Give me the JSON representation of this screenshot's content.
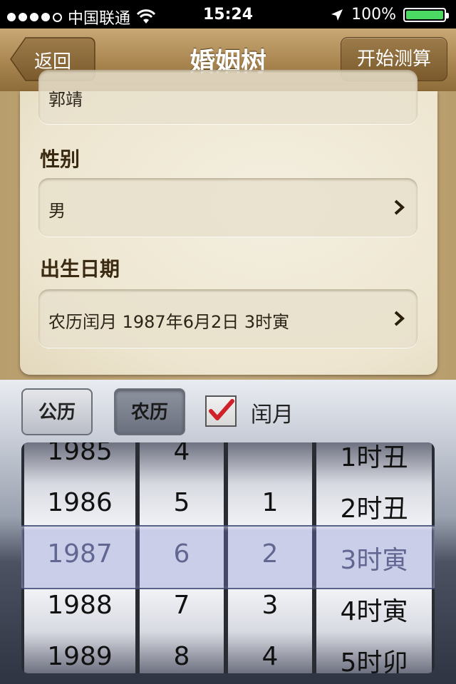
{
  "statusbar": {
    "carrier": "中国联通",
    "time": "15:24",
    "battery": "100%"
  },
  "navbar": {
    "back_label": "返回",
    "title": "婚姻树",
    "start_label": "开始测算"
  },
  "form": {
    "name_value": "郭靖",
    "gender_label": "性别",
    "gender_value": "男",
    "birth_label": "出生日期",
    "birth_value": "农历闰月 1987年6月2日 3时寅"
  },
  "picker": {
    "solar_label": "公历",
    "lunar_label": "农历",
    "leap_label": "闰月",
    "leap_checked": true,
    "columns": [
      {
        "name": "year",
        "rows": [
          "1985",
          "1986",
          "1987",
          "1988",
          "1989"
        ]
      },
      {
        "name": "month",
        "rows": [
          "4",
          "5",
          "6",
          "7",
          "8"
        ]
      },
      {
        "name": "day",
        "rows": [
          "",
          "1",
          "2",
          "3",
          "4"
        ]
      },
      {
        "name": "hour",
        "rows": [
          "1时丑",
          "2时丑",
          "3时寅",
          "4时寅",
          "5时卯"
        ]
      }
    ]
  },
  "colors": {
    "nav_brown": "#a98650",
    "battery_green": "#4bd964",
    "check_red": "#d0202a"
  }
}
